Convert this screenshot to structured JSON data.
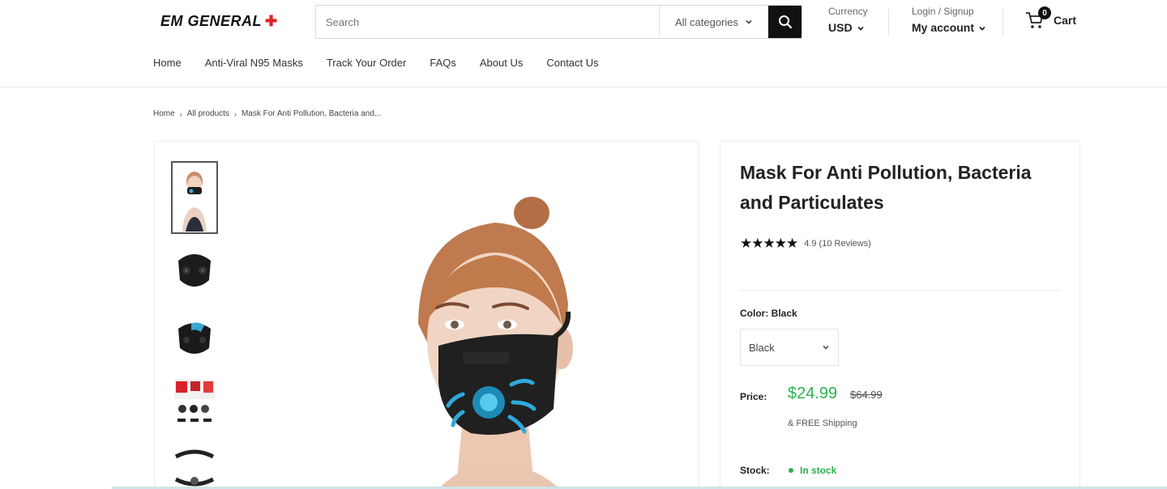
{
  "header": {
    "logo_text": "EM GENERAL",
    "search_placeholder": "Search",
    "category_label": "All categories",
    "currency_label": "Currency",
    "currency_value": "USD",
    "login_label": "Login / Signup",
    "account_label": "My account",
    "cart_count": "0",
    "cart_label": "Cart"
  },
  "nav": {
    "items": [
      "Home",
      "Anti-Viral N95 Masks",
      "Track Your Order",
      "FAQs",
      "About Us",
      "Contact Us"
    ]
  },
  "breadcrumb": {
    "home": "Home",
    "all_products": "All products",
    "current": "Mask For Anti Pollution, Bacteria and..."
  },
  "product": {
    "title": "Mask For Anti Pollution, Bacteria and Particulates",
    "stars": "★★★★★",
    "rating_text": "4.9 (10 Reviews)",
    "color_label": "Color:",
    "color_value": "Black",
    "select_value": "Black",
    "price_label": "Price:",
    "price": "$24.99",
    "compare_price": "$64.99",
    "shipping": "& FREE Shipping",
    "stock_label": "Stock:",
    "stock_value": "In stock"
  },
  "colors": {
    "accent_green": "#2bb24c",
    "search_button": "#111111",
    "logo_cross": "#dd2222"
  },
  "icons": [
    "search-icon",
    "chevron-down-icon",
    "cart-icon",
    "star-icon",
    "breadcrumb-chevron-icon"
  ]
}
